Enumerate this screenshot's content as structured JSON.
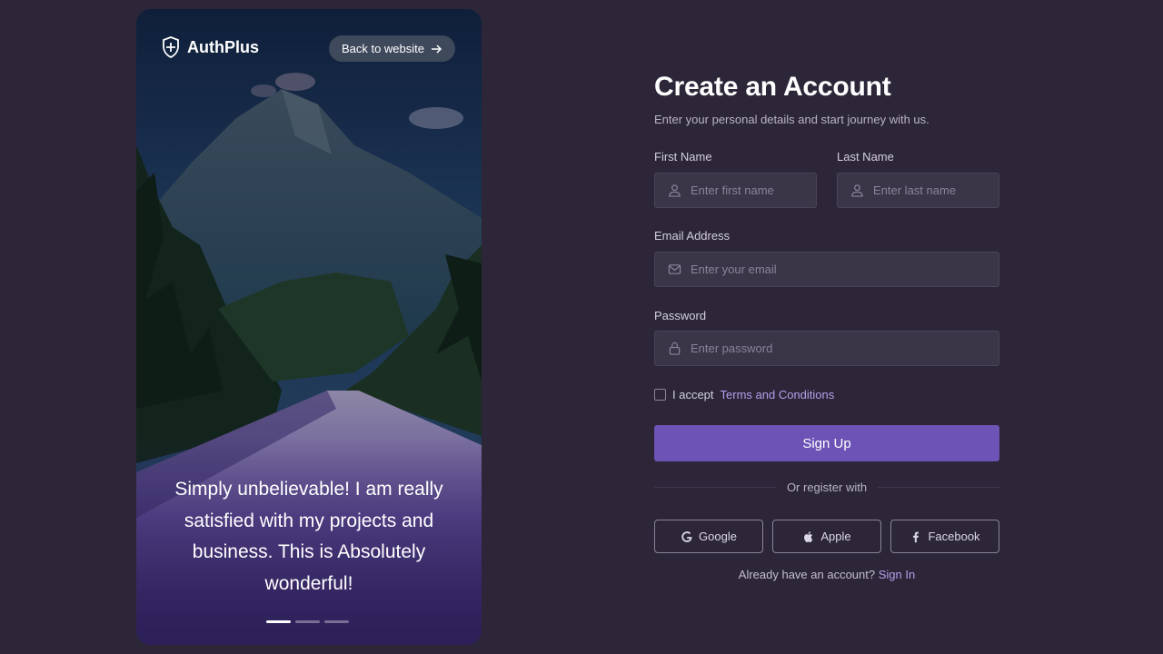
{
  "hero": {
    "brand_name": "AuthPlus",
    "back_label": "Back to website",
    "quote": "Simply unbelievable! I am really satisfied with my projects and business. This is Absolutely wonderful!",
    "carousel": {
      "slides": 3,
      "active_index": 0
    }
  },
  "form": {
    "title": "Create an Account",
    "subtitle": "Enter your personal details and start journey with us.",
    "first_name": {
      "label": "First Name",
      "placeholder": "Enter first name",
      "value": ""
    },
    "last_name": {
      "label": "Last Name",
      "placeholder": "Enter last name",
      "value": ""
    },
    "email": {
      "label": "Email Address",
      "placeholder": "Enter your email",
      "value": ""
    },
    "password": {
      "label": "Password",
      "placeholder": "Enter password",
      "value": ""
    },
    "terms": {
      "prefix": "I accept",
      "link": "Terms and Conditions",
      "checked": false
    },
    "signup_label": "Sign Up",
    "divider_text": "Or register with",
    "social": [
      {
        "label": "Google",
        "icon": "google-icon"
      },
      {
        "label": "Apple",
        "icon": "apple-icon"
      },
      {
        "label": "Facebook",
        "icon": "facebook-icon"
      }
    ],
    "signin": {
      "prompt": "Already have an account?",
      "link": "Sign In"
    }
  },
  "colors": {
    "background": "#2c2638",
    "input_bg": "#3b3548",
    "accent": "#6c53b5",
    "link": "#b3a0ec"
  }
}
